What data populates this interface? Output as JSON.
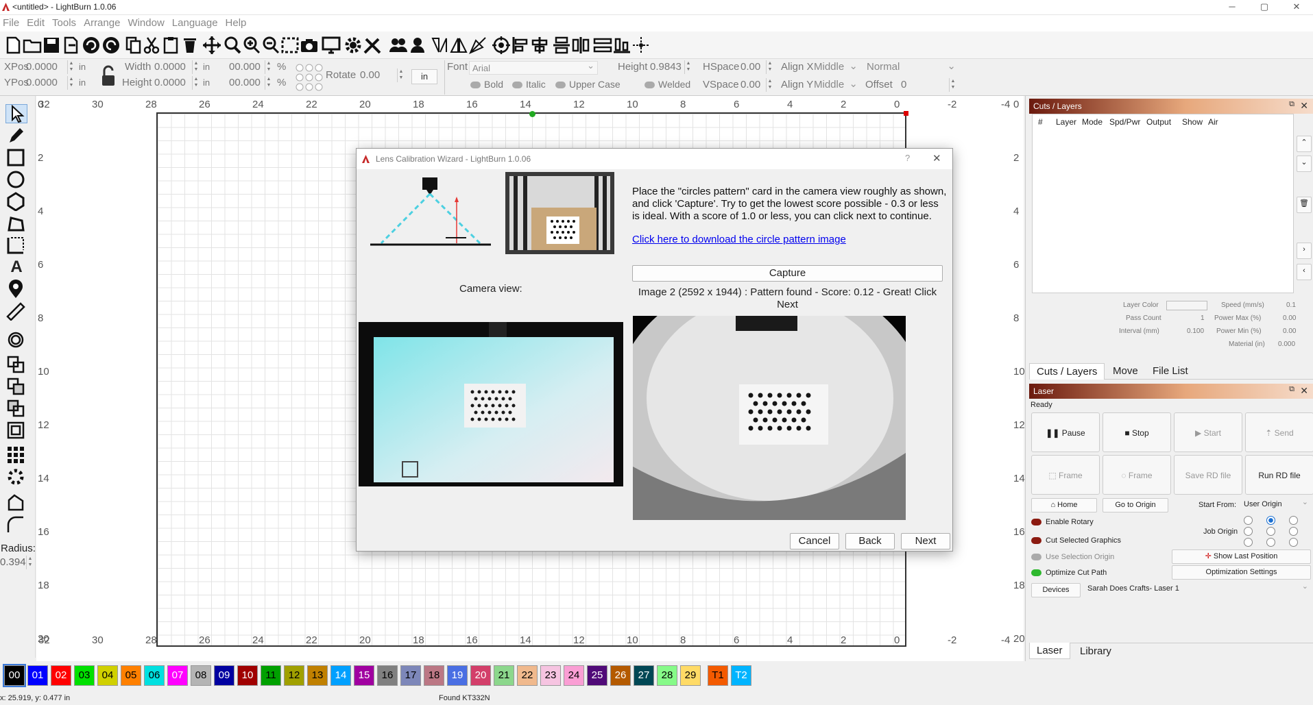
{
  "window": {
    "title": "<untitled> - LightBurn 1.0.06"
  },
  "menu": [
    "File",
    "Edit",
    "Tools",
    "Arrange",
    "Window",
    "Language",
    "Help"
  ],
  "props": {
    "xpos_label": "XPos",
    "xpos_value": "0.0000",
    "ypos_label": "YPos",
    "ypos_value": "0.0000",
    "unit": "in",
    "width_label": "Width",
    "width_value": "0.0000",
    "height_label": "Height",
    "height_value": "0.0000",
    "pct1": "00.000",
    "pct2": "00.000",
    "pct_sign": "%",
    "rotate_label": "Rotate",
    "rotate_value": "0.00",
    "unit_button": "in",
    "font_label": "Font",
    "font_value": "Arial",
    "fheight_label": "Height",
    "fheight_value": "0.9843",
    "hspace_label": "HSpace",
    "hspace_value": "0.00",
    "vspace_label": "VSpace",
    "vspace_value": "0.00",
    "alignx_label": "Align X",
    "alignx_value": "Middle",
    "aligny_label": "Align Y",
    "aligny_value": "Middle",
    "normal_value": "Normal",
    "offset_label": "Offset",
    "offset_value": "0",
    "bold": "Bold",
    "italic": "Italic",
    "upper": "Upper Case",
    "welded": "Welded"
  },
  "left_tools": {
    "radius_label": "Radius:",
    "radius_value": "0.394"
  },
  "ruler": {
    "top": [
      "32",
      "30",
      "28",
      "26",
      "24",
      "22",
      "20",
      "18",
      "16",
      "14",
      "12",
      "10",
      "8",
      "6",
      "4",
      "2",
      "0",
      "-2",
      "-4"
    ],
    "left": [
      "0",
      "2",
      "4",
      "6",
      "8",
      "10",
      "12",
      "14",
      "16",
      "18",
      "20"
    ],
    "right": [
      "0",
      "2",
      "4",
      "6",
      "8",
      "10",
      "12",
      "14",
      "16",
      "18",
      "20"
    ]
  },
  "cuts": {
    "title": "Cuts / Layers",
    "columns": [
      "#",
      "Layer",
      "Mode",
      "Spd/Pwr",
      "Output",
      "Show",
      "Air"
    ],
    "layer_color": "Layer Color",
    "speed_label": "Speed (mm/s)",
    "speed_value": "0.1",
    "pass_label": "Pass Count",
    "pass_value": "1",
    "pmax_label": "Power Max (%)",
    "pmax_value": "0.00",
    "interval_label": "Interval (mm)",
    "interval_value": "0.100",
    "pmin_label": "Power Min (%)",
    "pmin_value": "0.00",
    "material_label": "Material (in)",
    "material_value": "0.000",
    "tabs": [
      "Cuts / Layers",
      "Move",
      "File List"
    ]
  },
  "laser": {
    "title": "Laser",
    "status": "Ready",
    "pause": "Pause",
    "stop": "Stop",
    "start": "Start",
    "send": "Send",
    "frame1": "Frame",
    "frame2": "Frame",
    "save_rd": "Save RD file",
    "run_rd": "Run RD file",
    "home": "Home",
    "go_origin": "Go to Origin",
    "start_from_label": "Start From:",
    "start_from_value": "User Origin",
    "enable_rotary": "Enable Rotary",
    "job_origin": "Job Origin",
    "cut_selected": "Cut Selected Graphics",
    "use_selection": "Use Selection Origin",
    "show_last": "Show Last Position",
    "optimize": "Optimize Cut Path",
    "opt_settings": "Optimization Settings",
    "devices": "Devices",
    "device_value": "Sarah Does Crafts- Laser 1",
    "tabs": [
      "Laser",
      "Library"
    ]
  },
  "palette": [
    {
      "label": "00",
      "color": "#000000",
      "text": "#ffffff"
    },
    {
      "label": "01",
      "color": "#0000ff",
      "text": "#ffffff"
    },
    {
      "label": "02",
      "color": "#ff0000",
      "text": "#ffffff"
    },
    {
      "label": "03",
      "color": "#00e000",
      "text": "#000000"
    },
    {
      "label": "04",
      "color": "#d0d000",
      "text": "#000000"
    },
    {
      "label": "05",
      "color": "#ff8000",
      "text": "#000000"
    },
    {
      "label": "06",
      "color": "#00e0e0",
      "text": "#000000"
    },
    {
      "label": "07",
      "color": "#ff00ff",
      "text": "#ffffff"
    },
    {
      "label": "08",
      "color": "#b4b4b4",
      "text": "#000000"
    },
    {
      "label": "09",
      "color": "#0000a0",
      "text": "#ffffff"
    },
    {
      "label": "10",
      "color": "#a00000",
      "text": "#ffffff"
    },
    {
      "label": "11",
      "color": "#00a000",
      "text": "#000000"
    },
    {
      "label": "12",
      "color": "#a0a000",
      "text": "#000000"
    },
    {
      "label": "13",
      "color": "#c08000",
      "text": "#000000"
    },
    {
      "label": "14",
      "color": "#00a0ff",
      "text": "#ffffff"
    },
    {
      "label": "15",
      "color": "#a000a0",
      "text": "#ffffff"
    },
    {
      "label": "16",
      "color": "#808080",
      "text": "#000000"
    },
    {
      "label": "17",
      "color": "#7d87b9",
      "text": "#000000"
    },
    {
      "label": "18",
      "color": "#bb7784",
      "text": "#000000"
    },
    {
      "label": "19",
      "color": "#4a6fe3",
      "text": "#ffffff"
    },
    {
      "label": "20",
      "color": "#d33f6a",
      "text": "#ffffff"
    },
    {
      "label": "21",
      "color": "#8cd78c",
      "text": "#000000"
    },
    {
      "label": "22",
      "color": "#f0b98d",
      "text": "#000000"
    },
    {
      "label": "23",
      "color": "#f6c4e1",
      "text": "#000000"
    },
    {
      "label": "24",
      "color": "#fa9ed4",
      "text": "#000000"
    },
    {
      "label": "25",
      "color": "#500a78",
      "text": "#ffffff"
    },
    {
      "label": "26",
      "color": "#b45a00",
      "text": "#ffffff"
    },
    {
      "label": "27",
      "color": "#004754",
      "text": "#ffffff"
    },
    {
      "label": "28",
      "color": "#86fa88",
      "text": "#000000"
    },
    {
      "label": "29",
      "color": "#ffdb66",
      "text": "#000000"
    },
    {
      "label": "T1",
      "color": "#f35a00",
      "text": "#000000"
    },
    {
      "label": "T2",
      "color": "#00b4ff",
      "text": "#ffffff"
    }
  ],
  "status": {
    "coords": "x: 25.919, y: 0.477 in",
    "device": "Found KT332N"
  },
  "dialog": {
    "title": "Lens Calibration Wizard - LightBurn 1.0.06",
    "instructions": "Place the \"circles pattern\" card in the camera view roughly as shown, and click 'Capture'. Try to get the lowest score possible - 0.3 or less is ideal.  With a score of 1.0 or less, you can click next to continue.",
    "link": "Click here to download the circle pattern image",
    "camera_view": "Camera view:",
    "capture": "Capture",
    "result": "Image 2 (2592 x 1944) : Pattern found - Score: 0.12 - Great! Click Next",
    "cancel": "Cancel",
    "back": "Back",
    "next": "Next"
  }
}
